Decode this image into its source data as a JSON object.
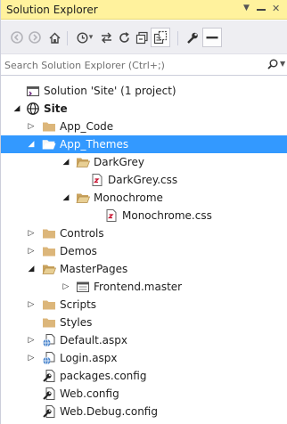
{
  "panel": {
    "title": "Solution Explorer"
  },
  "search": {
    "placeholder": "Search Solution Explorer (Ctrl+;)"
  },
  "tree": [
    {
      "label": "Solution 'Site' (1 project)",
      "icon": "solution-icon"
    },
    {
      "label": "Site",
      "icon": "website-globe-icon",
      "expanded": true,
      "bold": true
    },
    {
      "label": "App_Code",
      "icon": "folder-icon",
      "expanded": false
    },
    {
      "label": "App_Themes",
      "icon": "folder-open-icon",
      "expanded": true,
      "selected": true
    },
    {
      "label": "DarkGrey",
      "icon": "folder-open-icon",
      "expanded": true
    },
    {
      "label": "DarkGrey.css",
      "icon": "css-file-icon"
    },
    {
      "label": "Monochrome",
      "icon": "folder-open-icon",
      "expanded": true
    },
    {
      "label": "Monochrome.css",
      "icon": "css-file-icon"
    },
    {
      "label": "Controls",
      "icon": "folder-icon",
      "expanded": false
    },
    {
      "label": "Demos",
      "icon": "folder-icon",
      "expanded": false
    },
    {
      "label": "MasterPages",
      "icon": "folder-open-icon",
      "expanded": true
    },
    {
      "label": "Frontend.master",
      "icon": "master-page-icon",
      "expanded": false
    },
    {
      "label": "Scripts",
      "icon": "folder-icon",
      "expanded": false
    },
    {
      "label": "Styles",
      "icon": "folder-icon"
    },
    {
      "label": "Default.aspx",
      "icon": "aspx-file-icon",
      "expanded": false
    },
    {
      "label": "Login.aspx",
      "icon": "aspx-file-icon",
      "expanded": false
    },
    {
      "label": "packages.config",
      "icon": "config-file-icon"
    },
    {
      "label": "Web.config",
      "icon": "config-file-icon"
    },
    {
      "label": "Web.Debug.config",
      "icon": "config-file-icon"
    }
  ],
  "colors": {
    "title_bar": "#fff29d",
    "selection": "#3399ff",
    "toolbar": "#eeeef2",
    "folder": "#dcb67a"
  }
}
